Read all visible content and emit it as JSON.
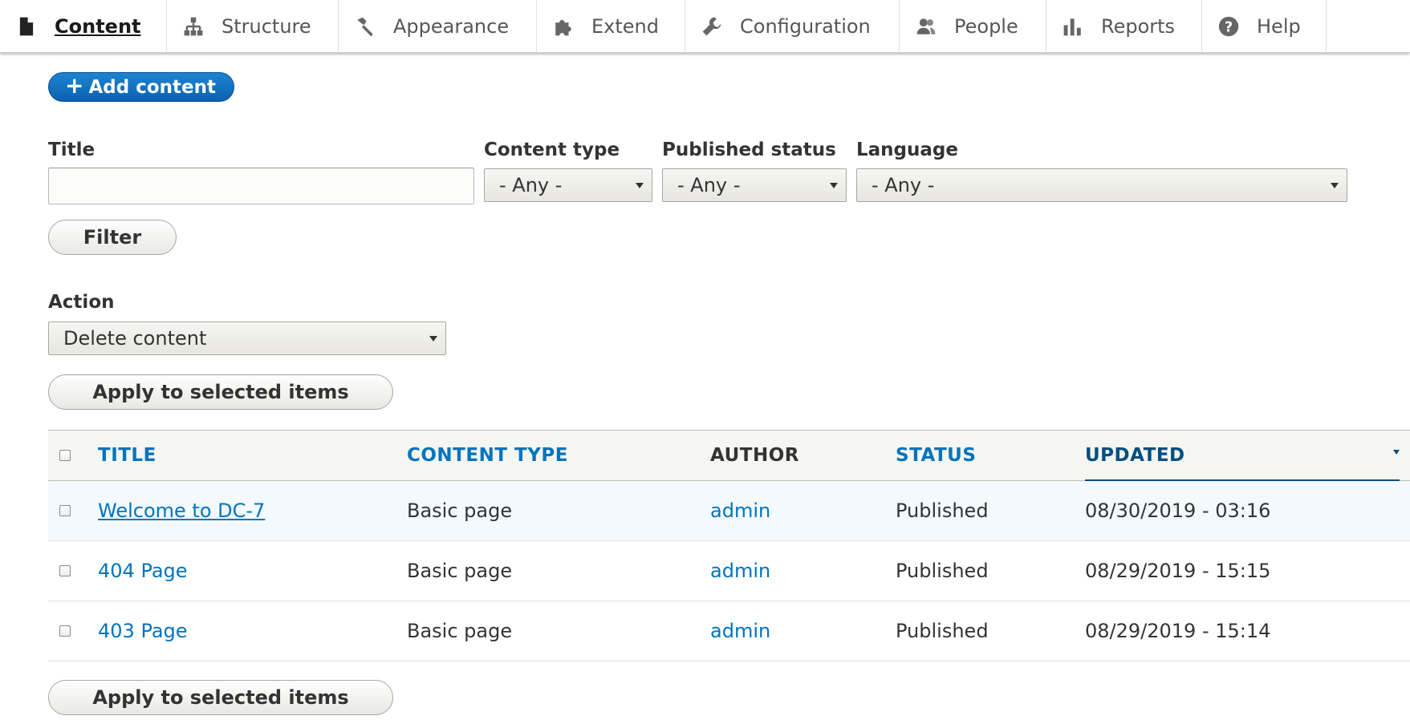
{
  "toolbar": {
    "items": [
      {
        "label": "Content",
        "icon": "file-icon",
        "active": true
      },
      {
        "label": "Structure",
        "icon": "sitemap-icon",
        "active": false
      },
      {
        "label": "Appearance",
        "icon": "paintbrush-icon",
        "active": false
      },
      {
        "label": "Extend",
        "icon": "puzzle-icon",
        "active": false
      },
      {
        "label": "Configuration",
        "icon": "wrench-icon",
        "active": false
      },
      {
        "label": "People",
        "icon": "people-icon",
        "active": false
      },
      {
        "label": "Reports",
        "icon": "bar-chart-icon",
        "active": false
      },
      {
        "label": "Help",
        "icon": "help-icon",
        "active": false
      }
    ]
  },
  "actions": {
    "add_content_label": "Add content"
  },
  "filters": {
    "title_label": "Title",
    "title_value": "",
    "content_type_label": "Content type",
    "content_type_value": "- Any -",
    "published_status_label": "Published status",
    "published_status_value": "- Any -",
    "language_label": "Language",
    "language_value": "- Any -",
    "filter_button": "Filter"
  },
  "bulk": {
    "action_label": "Action",
    "action_value": "Delete content",
    "apply_button": "Apply to selected items"
  },
  "table": {
    "headers": {
      "title": "TITLE",
      "content_type": "CONTENT TYPE",
      "author": "AUTHOR",
      "status": "STATUS",
      "updated": "UPDATED"
    },
    "rows": [
      {
        "title": "Welcome to DC-7",
        "content_type": "Basic page",
        "author": "admin",
        "status": "Published",
        "updated": "08/30/2019 - 03:16"
      },
      {
        "title": "404 Page",
        "content_type": "Basic page",
        "author": "admin",
        "status": "Published",
        "updated": "08/29/2019 - 15:15"
      },
      {
        "title": "403 Page",
        "content_type": "Basic page",
        "author": "admin",
        "status": "Published",
        "updated": "08/29/2019 - 15:14"
      }
    ]
  },
  "colors": {
    "link": "#0074bd",
    "primary_button": "#0b67b6",
    "sorted_header": "#004f80"
  }
}
